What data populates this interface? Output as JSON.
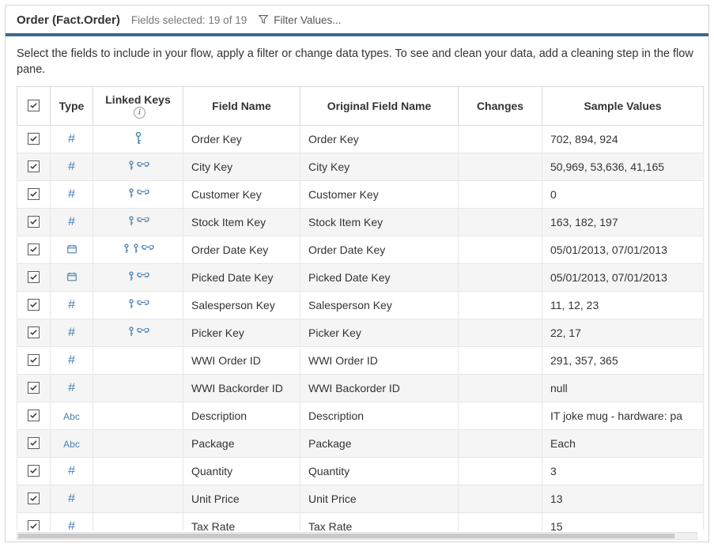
{
  "header": {
    "title": "Order (Fact.Order)",
    "fields_selected": "Fields selected: 19 of 19",
    "filter_label": "Filter Values..."
  },
  "instruction": "Select the fields to include in your flow, apply a filter or change data types. To see and clean your data, add a cleaning step in the flow pane.",
  "columns": {
    "checkbox": "",
    "type": "Type",
    "linked_keys": "Linked Keys",
    "field_name": "Field Name",
    "original_name": "Original Field Name",
    "changes": "Changes",
    "sample": "Sample Values"
  },
  "rows": [
    {
      "checked": true,
      "type": "number",
      "linked": "key_single",
      "field": "Order Key",
      "orig": "Order Key",
      "changes": "",
      "sample": "702, 894, 924"
    },
    {
      "checked": true,
      "type": "number",
      "linked": "key_link",
      "field": "City Key",
      "orig": "City Key",
      "changes": "",
      "sample": "50,969, 53,636, 41,165"
    },
    {
      "checked": true,
      "type": "number",
      "linked": "key_link",
      "field": "Customer Key",
      "orig": "Customer Key",
      "changes": "",
      "sample": "0"
    },
    {
      "checked": true,
      "type": "number",
      "linked": "key_link",
      "field": "Stock Item Key",
      "orig": "Stock Item Key",
      "changes": "",
      "sample": "163, 182, 197"
    },
    {
      "checked": true,
      "type": "date",
      "linked": "key_both",
      "field": "Order Date Key",
      "orig": "Order Date Key",
      "changes": "",
      "sample": "05/01/2013, 07/01/2013"
    },
    {
      "checked": true,
      "type": "date",
      "linked": "key_link",
      "field": "Picked Date Key",
      "orig": "Picked Date Key",
      "changes": "",
      "sample": "05/01/2013, 07/01/2013"
    },
    {
      "checked": true,
      "type": "number",
      "linked": "key_link",
      "field": "Salesperson Key",
      "orig": "Salesperson Key",
      "changes": "",
      "sample": "11, 12, 23"
    },
    {
      "checked": true,
      "type": "number",
      "linked": "key_link",
      "field": "Picker Key",
      "orig": "Picker Key",
      "changes": "",
      "sample": "22, 17"
    },
    {
      "checked": true,
      "type": "number",
      "linked": "",
      "field": "WWI Order ID",
      "orig": "WWI Order ID",
      "changes": "",
      "sample": "291, 357, 365"
    },
    {
      "checked": true,
      "type": "number",
      "linked": "",
      "field": "WWI Backorder ID",
      "orig": "WWI Backorder ID",
      "changes": "",
      "sample": "null"
    },
    {
      "checked": true,
      "type": "string",
      "linked": "",
      "field": "Description",
      "orig": "Description",
      "changes": "",
      "sample": "IT joke mug - hardware: pa"
    },
    {
      "checked": true,
      "type": "string",
      "linked": "",
      "field": "Package",
      "orig": "Package",
      "changes": "",
      "sample": "Each"
    },
    {
      "checked": true,
      "type": "number",
      "linked": "",
      "field": "Quantity",
      "orig": "Quantity",
      "changes": "",
      "sample": "3"
    },
    {
      "checked": true,
      "type": "number",
      "linked": "",
      "field": "Unit Price",
      "orig": "Unit Price",
      "changes": "",
      "sample": "13"
    },
    {
      "checked": true,
      "type": "number",
      "linked": "",
      "field": "Tax Rate",
      "orig": "Tax Rate",
      "changes": "",
      "sample": "15"
    }
  ]
}
